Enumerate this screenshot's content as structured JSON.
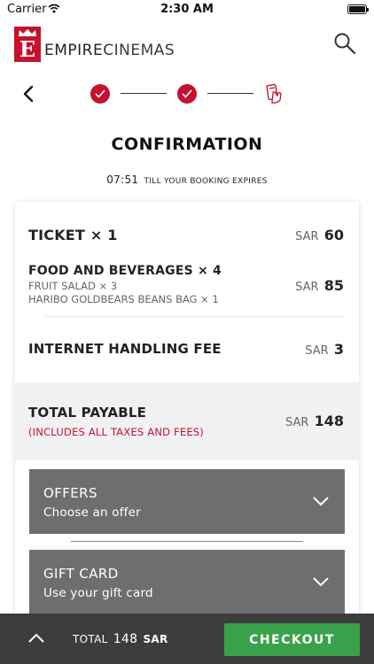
{
  "status_bar": {
    "carrier": "Carrier",
    "time": "2:30 AM"
  },
  "header": {
    "brand_bold": "EMPIRE",
    "brand_light": "CINEMAS",
    "logo_letter": "E"
  },
  "colors": {
    "brand_red": "#c4122f",
    "checkout_green": "#3aa14b",
    "accordion_gray": "#6e6e6e",
    "bottom_bar": "#3d3d3d"
  },
  "steps": {
    "icons": [
      "check-icon",
      "check-icon",
      "payment-card-icon"
    ]
  },
  "page": {
    "title": "CONFIRMATION",
    "timer": "07:51",
    "timer_text": "TILL YOUR BOOKING EXPIRES"
  },
  "summary": {
    "ticket": {
      "label": "TICKET × 1",
      "currency": "SAR",
      "amount": "60"
    },
    "food": {
      "label": "FOOD AND BEVERAGES × 4",
      "items": [
        "FRUIT SALAD × 3",
        "HARIBO GOLDBEARS BEANS BAG × 1"
      ],
      "currency": "SAR",
      "amount": "85"
    },
    "fee": {
      "label": "INTERNET HANDLING FEE",
      "currency": "SAR",
      "amount": "3"
    },
    "total": {
      "label": "TOTAL PAYABLE",
      "note": "(INCLUDES ALL TAXES AND FEES)",
      "currency": "SAR",
      "amount": "148"
    }
  },
  "offers": {
    "title": "OFFERS",
    "subtitle": "Choose an offer"
  },
  "gift_card": {
    "title": "GIFT CARD",
    "subtitle": "Use your gift card"
  },
  "bottom_bar": {
    "total_label": "TOTAL",
    "total_amount": "148",
    "total_currency": "SAR",
    "checkout_label": "CHECKOUT"
  }
}
